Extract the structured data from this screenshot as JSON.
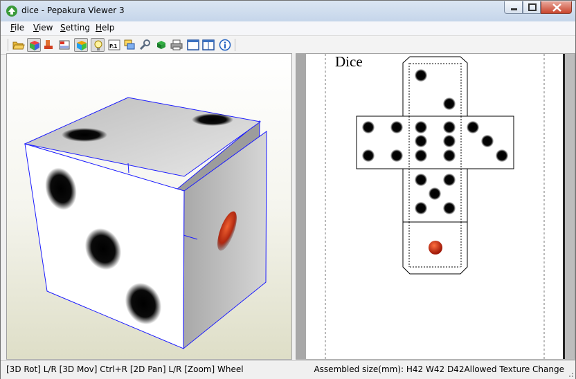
{
  "window": {
    "title": "dice - Pepakura Viewer 3"
  },
  "menu": {
    "file": {
      "first": "F",
      "rest": "ile"
    },
    "view": {
      "first": "V",
      "rest": "iew"
    },
    "setting": {
      "first": "S",
      "rest": "etting"
    },
    "help": {
      "first": "H",
      "rest": "elp"
    }
  },
  "toolbar": {
    "buttons": [
      "open-folder-icon",
      "3d-model-icon",
      "eraser-icon",
      "fold-lines-icon",
      "texture-cube-icon",
      "light-bulb-icon",
      "page-number-icon",
      "stack-icon",
      "wrench-icon",
      "assembly-icon",
      "print-icon",
      "single-view-icon",
      "dual-view-icon",
      "info-icon"
    ],
    "page_label": "P.1"
  },
  "sheet": {
    "title": "Dice"
  },
  "status": {
    "left": "[3D Rot] L/R [3D Mov] Ctrl+R [2D Pan] L/R [Zoom] Wheel",
    "right": "Assembled size(mm): H42 W42 D42Allowed Texture Change"
  },
  "colors": {
    "edge_blue": "#1a1aff",
    "pip_red": "#c83010"
  }
}
